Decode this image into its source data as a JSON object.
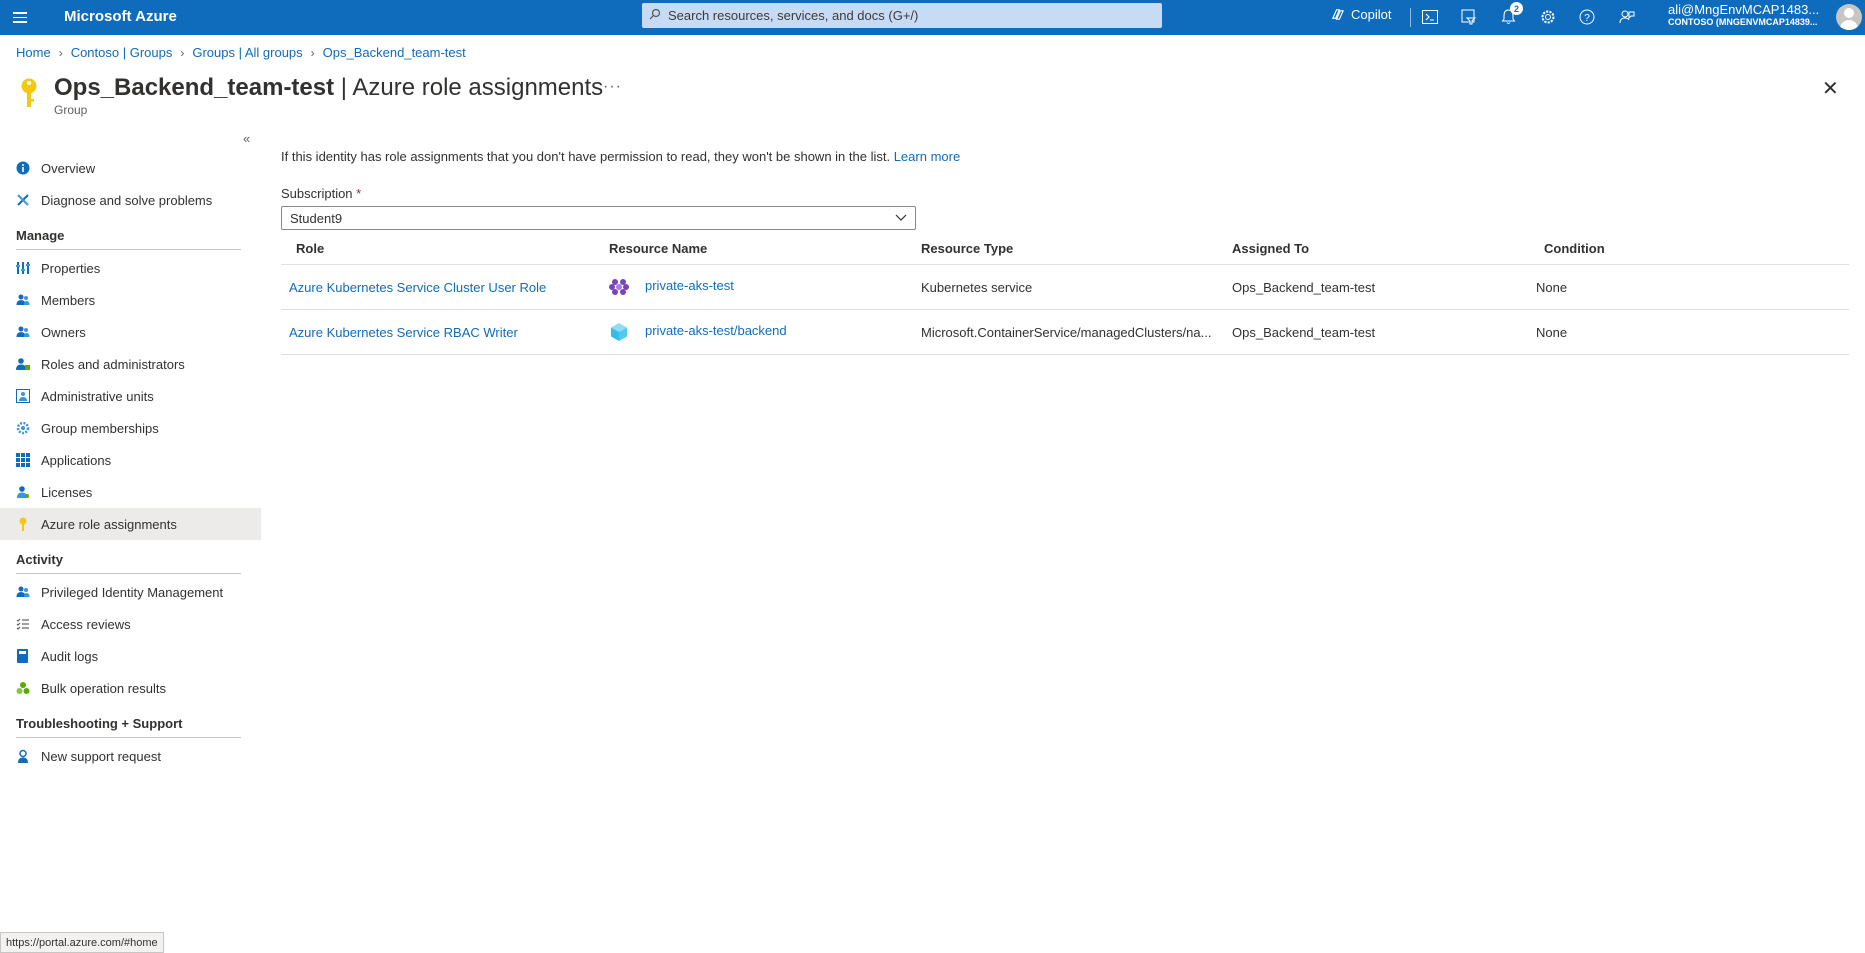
{
  "topbar": {
    "brand": "Microsoft Azure",
    "search_placeholder": "Search resources, services, and docs (G+/)",
    "copilot_label": "Copilot",
    "notification_count": "2",
    "account_name": "ali@MngEnvMCAP1483...",
    "account_tenant": "CONTOSO (MNGENVMCAP14839..."
  },
  "breadcrumb": [
    "Home",
    "Contoso | Groups",
    "Groups | All groups",
    "Ops_Backend_team-test"
  ],
  "header": {
    "name": "Ops_Backend_team-test",
    "separator": " | ",
    "blade": "Azure role assignments",
    "type": "Group",
    "more": "···"
  },
  "sidebar": {
    "collapse": "«",
    "top_items": [
      {
        "label": "Overview",
        "icon": "info-icon"
      },
      {
        "label": "Diagnose and solve problems",
        "icon": "wrench-icon"
      }
    ],
    "manage_header": "Manage",
    "manage_items": [
      {
        "label": "Properties",
        "icon": "properties-icon"
      },
      {
        "label": "Members",
        "icon": "members-icon"
      },
      {
        "label": "Owners",
        "icon": "owners-icon"
      },
      {
        "label": "Roles and administrators",
        "icon": "roles-icon"
      },
      {
        "label": "Administrative units",
        "icon": "admin-units-icon"
      },
      {
        "label": "Group memberships",
        "icon": "gear-icon"
      },
      {
        "label": "Applications",
        "icon": "apps-grid-icon"
      },
      {
        "label": "Licenses",
        "icon": "licenses-icon"
      },
      {
        "label": "Azure role assignments",
        "icon": "key-icon"
      }
    ],
    "activity_header": "Activity",
    "activity_items": [
      {
        "label": "Privileged Identity Management",
        "icon": "pim-icon"
      },
      {
        "label": "Access reviews",
        "icon": "checklist-icon"
      },
      {
        "label": "Audit logs",
        "icon": "book-icon"
      },
      {
        "label": "Bulk operation results",
        "icon": "bulk-icon"
      }
    ],
    "support_header": "Troubleshooting + Support",
    "support_items": [
      {
        "label": "New support request",
        "icon": "support-person-icon"
      }
    ]
  },
  "main": {
    "info_text": "If this identity has role assignments that you don't have permission to read, they won't be shown in the list.",
    "learn_more": "Learn more",
    "subscription_label": "Subscription",
    "required_marker": "*",
    "subscription_value": "Student9",
    "columns": [
      "Role",
      "Resource Name",
      "Resource Type",
      "Assigned To",
      "Condition"
    ],
    "rows": [
      {
        "role": "Azure Kubernetes Service Cluster User Role",
        "resource_name": "private-aks-test",
        "resource_icon": "kubernetes-icon",
        "resource_type": "Kubernetes service",
        "assigned_to": "Ops_Backend_team-test",
        "condition": "None"
      },
      {
        "role": "Azure Kubernetes Service RBAC Writer",
        "resource_name": "private-aks-test/backend",
        "resource_icon": "cube-icon",
        "resource_type": "Microsoft.ContainerService/managedClusters/na...",
        "assigned_to": "Ops_Backend_team-test",
        "condition": "None"
      }
    ]
  },
  "statusbar": {
    "url": "https://portal.azure.com/#home"
  },
  "colors": {
    "topbar": "#0f6cbd",
    "link": "#0f6cbd",
    "active_nav": "#edebe9"
  }
}
